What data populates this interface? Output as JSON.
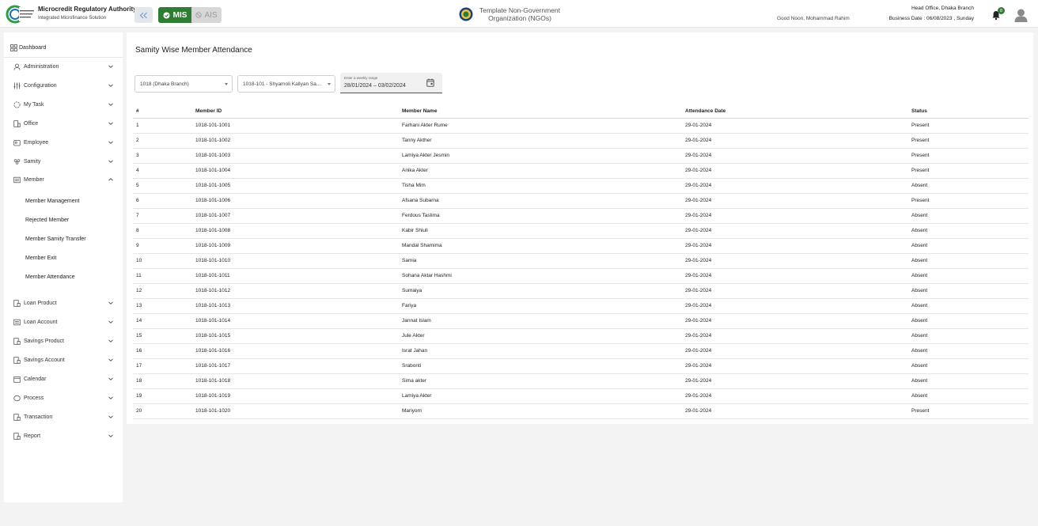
{
  "header": {
    "brand_title": "Microcredit Regulatory Authority",
    "brand_subtitle": "Integrated Microfinance Solution",
    "mode_mis": "MIS",
    "mode_ais": "AIS",
    "org_name_line1": "Template Non-Government",
    "org_name_line2": "Organization (NGOs)",
    "greeting": "Good Noon, Mohammad Rahim",
    "office": "Head Office, Dhaka Branch",
    "business_date": "Business Date : 06/08/2023 , Sunday",
    "notification_count": "8",
    "colors": {
      "accent": "#2e7d32",
      "ais_bg": "#d7d7d7"
    }
  },
  "sidebar": {
    "dashboard": "Dashboard",
    "items": [
      {
        "label": "Administration",
        "icon": "admin-icon"
      },
      {
        "label": "Configuration",
        "icon": "config-icon"
      },
      {
        "label": "My Task",
        "icon": "task-icon"
      },
      {
        "label": "Office",
        "icon": "office-icon"
      },
      {
        "label": "Employee",
        "icon": "employee-icon"
      },
      {
        "label": "Samity",
        "icon": "samity-icon"
      },
      {
        "label": "Member",
        "icon": "member-icon",
        "expanded": true
      }
    ],
    "member_sub": [
      "Member Management",
      "Rejected Member",
      "Member Samity Transfer",
      "Member Exit",
      "Member Attendance"
    ],
    "items_after": [
      {
        "label": "Loan Product",
        "icon": "doc-icon"
      },
      {
        "label": "Loan Account",
        "icon": "account-icon"
      },
      {
        "label": "Savings Product",
        "icon": "doc-icon"
      },
      {
        "label": "Savings Account",
        "icon": "doc-icon"
      },
      {
        "label": "Calendar",
        "icon": "calendar-icon"
      },
      {
        "label": "Process",
        "icon": "process-icon"
      },
      {
        "label": "Transaction",
        "icon": "doc-icon"
      },
      {
        "label": "Report",
        "icon": "doc-icon"
      }
    ]
  },
  "main": {
    "title": "Samity Wise Member Attendance",
    "branch_select": "1018 (Dhaka Branch)",
    "samity_select": "1018-101 - Shyamoli Kallyan Sa...",
    "date_label": "Enter a weekly range",
    "date_value": "28/01/2024 – 03/02/2024",
    "columns": [
      "#",
      "Member ID",
      "Member Name",
      "Attendance Date",
      "Status"
    ],
    "rows": [
      [
        "1",
        "1018-101-1001",
        "Farhani Akter Rume",
        "29-01-2024",
        "Present"
      ],
      [
        "2",
        "1018-101-1002",
        "Tanny Akther",
        "29-01-2024",
        "Present"
      ],
      [
        "3",
        "1018-101-1003",
        "Lamiya Akter Jesmin",
        "29-01-2024",
        "Present"
      ],
      [
        "4",
        "1018-101-1004",
        "Anika Akter",
        "29-01-2024",
        "Present"
      ],
      [
        "5",
        "1018-101-1005",
        "Tisha Mim",
        "29-01-2024",
        "Absent"
      ],
      [
        "6",
        "1018-101-1006",
        "Afsana Subarna",
        "29-01-2024",
        "Present"
      ],
      [
        "7",
        "1018-101-1007",
        "Ferdous Taslima",
        "29-01-2024",
        "Absent"
      ],
      [
        "8",
        "1018-101-1008",
        "Kabir Shiuli",
        "29-01-2024",
        "Absent"
      ],
      [
        "9",
        "1018-101-1009",
        "Mandal Shamima",
        "29-01-2024",
        "Absent"
      ],
      [
        "10",
        "1018-101-1010",
        "Samia",
        "29-01-2024",
        "Absent"
      ],
      [
        "11",
        "1018-101-1011",
        "Sohana Aktar Hashmi",
        "29-01-2024",
        "Absent"
      ],
      [
        "12",
        "1018-101-1012",
        "Sumaiya",
        "29-01-2024",
        "Absent"
      ],
      [
        "13",
        "1018-101-1013",
        "Fariya",
        "29-01-2024",
        "Absent"
      ],
      [
        "14",
        "1018-101-1014",
        "Jannat Islam",
        "29-01-2024",
        "Absent"
      ],
      [
        "15",
        "1018-101-1015",
        "Jule Akter",
        "29-01-2024",
        "Absent"
      ],
      [
        "16",
        "1018-101-1016",
        "Israt Jahan",
        "29-01-2024",
        "Absent"
      ],
      [
        "17",
        "1018-101-1017",
        "Srabonti",
        "29-01-2024",
        "Absent"
      ],
      [
        "18",
        "1018-101-1018",
        "Sima akter",
        "29-01-2024",
        "Absent"
      ],
      [
        "19",
        "1018-101-1019",
        "Lamiya Akter",
        "29-01-2024",
        "Absent"
      ],
      [
        "20",
        "1018-101-1020",
        "Mariyom",
        "29-01-2024",
        "Present"
      ]
    ]
  }
}
